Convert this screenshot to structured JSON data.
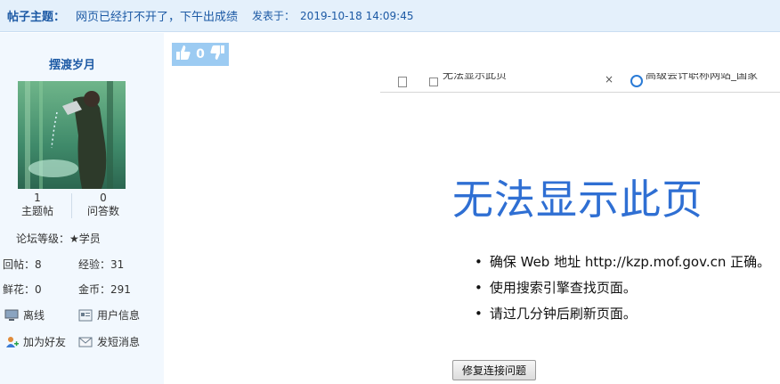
{
  "header": {
    "label": "帖子主题：",
    "subject": "网页已经打不开了，下午出成绩",
    "posted_label": "发表于：",
    "posted_time": "2019-10-18 14:09:45"
  },
  "user": {
    "name": "摆渡岁月",
    "topics_count": "1",
    "topics_label": "主题帖",
    "answers_count": "0",
    "answers_label": "问答数",
    "level": "论坛等级：★学员",
    "replies": "回帖：8",
    "experience": "经验：31",
    "flowers": "鲜花：0",
    "coins": "金币：291",
    "actions": {
      "offline": "离线",
      "user_info": "用户信息",
      "add_friend": "加为好友",
      "send_message": "发短消息"
    }
  },
  "like": {
    "count": "0"
  },
  "embedded": {
    "tab1": "无法显示此页",
    "tab2": "高级会计职称网站_国家",
    "error_title": "无法显示此页",
    "bullets": [
      "确保 Web 地址 http://kzp.mof.gov.cn 正确。",
      "使用搜索引擎查找页面。",
      "请过几分钟后刷新页面。"
    ],
    "fix_button": "修复连接问题"
  },
  "colors": {
    "header_bg": "#e4f0fb",
    "link_blue": "#1d5aa5",
    "sidebar_bg": "#f2f8fe",
    "error_blue": "#2f6fd3",
    "like_bg": "#9ccbf2"
  }
}
